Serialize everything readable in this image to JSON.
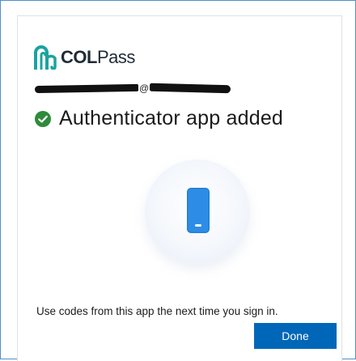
{
  "brand": {
    "name_bold": "COL",
    "name_light": "Pass",
    "logo_icon": "colpass-logo-icon",
    "color": "#1aa3a0"
  },
  "account": {
    "at_sign": "@",
    "redacted": true
  },
  "status": {
    "icon": "check-circle-icon",
    "color": "#2f8a3b",
    "title": "Authenticator app added"
  },
  "illustration": {
    "icon": "phone-icon",
    "color": "#1f7fd6"
  },
  "message": "Use codes from this app the next time you sign in.",
  "actions": {
    "done_label": "Done",
    "accent": "#0067b8"
  }
}
